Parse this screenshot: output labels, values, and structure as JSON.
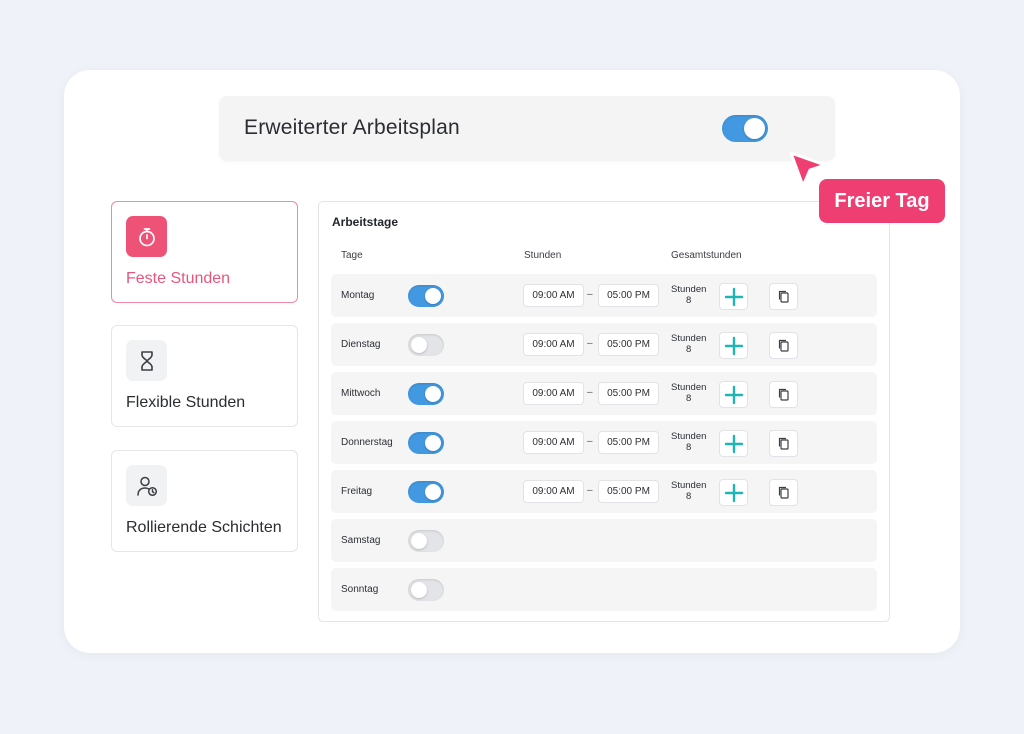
{
  "header": {
    "title": "Erweiterter Arbeitsplan",
    "toggle_on": true
  },
  "badge": {
    "label": "Freier Tag"
  },
  "options": [
    {
      "label": "Feste Stunden",
      "icon": "stopwatch-icon",
      "active": true
    },
    {
      "label": "Flexible Stunden",
      "icon": "hourglass-icon",
      "active": false
    },
    {
      "label": "Rollierende Schichten",
      "icon": "user-clock-icon",
      "active": false
    }
  ],
  "table": {
    "title": "Arbeitstage",
    "columns": {
      "days": "Tage",
      "hours": "Stunden",
      "total": "Gesamtstunden"
    },
    "rows": [
      {
        "day": "Montag",
        "enabled": true,
        "start": "09:00  AM",
        "end": "05:00  PM",
        "total_label": "Stunden",
        "total_value": "8"
      },
      {
        "day": "Dienstag",
        "enabled": false,
        "start": "09:00  AM",
        "end": "05:00  PM",
        "total_label": "Stunden",
        "total_value": "8"
      },
      {
        "day": "Mittwoch",
        "enabled": true,
        "start": "09:00  AM",
        "end": "05:00  PM",
        "total_label": "Stunden",
        "total_value": "8"
      },
      {
        "day": "Donnerstag",
        "enabled": true,
        "start": "09:00  AM",
        "end": "05:00  PM",
        "total_label": "Stunden",
        "total_value": "8"
      },
      {
        "day": "Freitag",
        "enabled": true,
        "start": "09:00  AM",
        "end": "05:00  PM",
        "total_label": "Stunden",
        "total_value": "8"
      },
      {
        "day": "Samstag",
        "enabled": false
      },
      {
        "day": "Sonntag",
        "enabled": false
      }
    ],
    "separator": "–"
  },
  "colors": {
    "accent_pink": "#ee3e72",
    "toggle_blue": "#4299e1",
    "plus_teal": "#1fb5b5"
  }
}
